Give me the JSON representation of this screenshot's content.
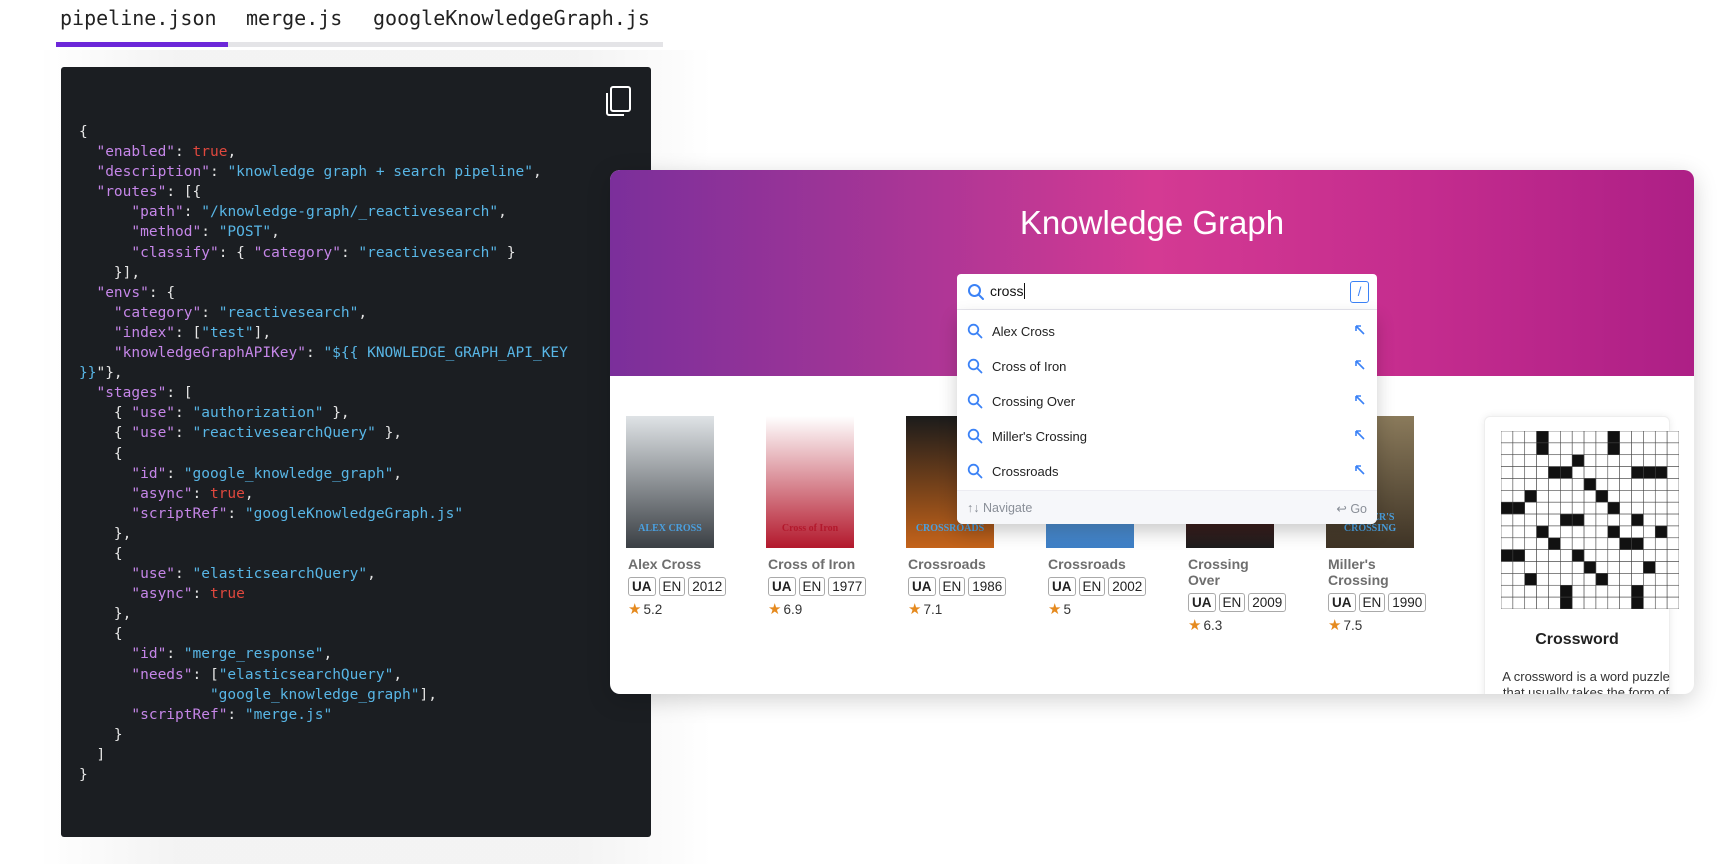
{
  "tabs": [
    {
      "label": "pipeline.json",
      "active": true
    },
    {
      "label": "merge.js",
      "active": false
    },
    {
      "label": "googleKnowledgeGraph.js",
      "active": false
    }
  ],
  "accent_color": "#6d28d9",
  "code_panel": {
    "copy_icon": "copy-icon",
    "lines": [
      [
        [
          "p",
          "{"
        ]
      ],
      [
        [
          "p",
          "  "
        ],
        [
          "k",
          "\"enabled\""
        ],
        [
          "p",
          ": "
        ],
        [
          "b",
          "true"
        ],
        [
          "p",
          ","
        ]
      ],
      [
        [
          "p",
          "  "
        ],
        [
          "k",
          "\"description\""
        ],
        [
          "p",
          ": "
        ],
        [
          "s",
          "\"knowledge graph + search pipeline\""
        ],
        [
          "p",
          ","
        ]
      ],
      [
        [
          "p",
          "  "
        ],
        [
          "k",
          "\"routes\""
        ],
        [
          "p",
          ": [{"
        ]
      ],
      [
        [
          "p",
          "      "
        ],
        [
          "k",
          "\"path\""
        ],
        [
          "p",
          ": "
        ],
        [
          "s",
          "\"/knowledge-graph/_reactivesearch\""
        ],
        [
          "p",
          ","
        ]
      ],
      [
        [
          "p",
          "      "
        ],
        [
          "k",
          "\"method\""
        ],
        [
          "p",
          ": "
        ],
        [
          "s",
          "\"POST\""
        ],
        [
          "p",
          ","
        ]
      ],
      [
        [
          "p",
          "      "
        ],
        [
          "k",
          "\"classify\""
        ],
        [
          "p",
          ": { "
        ],
        [
          "k",
          "\"category\""
        ],
        [
          "p",
          ": "
        ],
        [
          "s",
          "\"reactivesearch\""
        ],
        [
          "p",
          " }"
        ]
      ],
      [
        [
          "p",
          "    }],"
        ]
      ],
      [
        [
          "p",
          "  "
        ],
        [
          "k",
          "\"envs\""
        ],
        [
          "p",
          ": {"
        ]
      ],
      [
        [
          "p",
          "    "
        ],
        [
          "k",
          "\"category\""
        ],
        [
          "p",
          ": "
        ],
        [
          "s",
          "\"reactivesearch\""
        ],
        [
          "p",
          ","
        ]
      ],
      [
        [
          "p",
          "    "
        ],
        [
          "k",
          "\"index\""
        ],
        [
          "p",
          ": ["
        ],
        [
          "s",
          "\"test\""
        ],
        [
          "p",
          "],"
        ]
      ],
      [
        [
          "p",
          "    "
        ],
        [
          "k",
          "\"knowledgeGraphAPIKey\""
        ],
        [
          "p",
          ": "
        ],
        [
          "s",
          "\"${{ KNOWLEDGE_GRAPH_API_KEY"
        ]
      ],
      [
        [
          "s",
          "}}"
        ],
        [
          "p",
          "\"},"
        ]
      ],
      [
        [
          "p",
          "  "
        ],
        [
          "k",
          "\"stages\""
        ],
        [
          "p",
          ": ["
        ]
      ],
      [
        [
          "p",
          "    { "
        ],
        [
          "k",
          "\"use\""
        ],
        [
          "p",
          ": "
        ],
        [
          "s",
          "\"authorization\""
        ],
        [
          "p",
          " },"
        ]
      ],
      [
        [
          "p",
          "    { "
        ],
        [
          "k",
          "\"use\""
        ],
        [
          "p",
          ": "
        ],
        [
          "s",
          "\"reactivesearchQuery\""
        ],
        [
          "p",
          " },"
        ]
      ],
      [
        [
          "p",
          "    {"
        ]
      ],
      [
        [
          "p",
          "      "
        ],
        [
          "k",
          "\"id\""
        ],
        [
          "p",
          ": "
        ],
        [
          "s",
          "\"google_knowledge_graph\""
        ],
        [
          "p",
          ","
        ]
      ],
      [
        [
          "p",
          "      "
        ],
        [
          "k",
          "\"async\""
        ],
        [
          "p",
          ": "
        ],
        [
          "b",
          "true"
        ],
        [
          "p",
          ","
        ]
      ],
      [
        [
          "p",
          "      "
        ],
        [
          "k",
          "\"scriptRef\""
        ],
        [
          "p",
          ": "
        ],
        [
          "s",
          "\"googleKnowledgeGraph.js\""
        ]
      ],
      [
        [
          "p",
          "    },"
        ]
      ],
      [
        [
          "p",
          "    {"
        ]
      ],
      [
        [
          "p",
          "      "
        ],
        [
          "k",
          "\"use\""
        ],
        [
          "p",
          ": "
        ],
        [
          "s",
          "\"elasticsearchQuery\""
        ],
        [
          "p",
          ","
        ]
      ],
      [
        [
          "p",
          "      "
        ],
        [
          "k",
          "\"async\""
        ],
        [
          "p",
          ": "
        ],
        [
          "b",
          "true"
        ]
      ],
      [
        [
          "p",
          "    },"
        ]
      ],
      [
        [
          "p",
          "    {"
        ]
      ],
      [
        [
          "p",
          "      "
        ],
        [
          "k",
          "\"id\""
        ],
        [
          "p",
          ": "
        ],
        [
          "s",
          "\"merge_response\""
        ],
        [
          "p",
          ","
        ]
      ],
      [
        [
          "p",
          "      "
        ],
        [
          "k",
          "\"needs\""
        ],
        [
          "p",
          ": ["
        ],
        [
          "s",
          "\"elasticsearchQuery\""
        ],
        [
          "p",
          ","
        ]
      ],
      [
        [
          "p",
          "               "
        ],
        [
          "s",
          "\"google_knowledge_graph\""
        ],
        [
          "p",
          "],"
        ]
      ],
      [
        [
          "p",
          "      "
        ],
        [
          "k",
          "\"scriptRef\""
        ],
        [
          "p",
          ": "
        ],
        [
          "s",
          "\"merge.js\""
        ]
      ],
      [
        [
          "p",
          "    }"
        ]
      ],
      [
        [
          "p",
          "  ]"
        ]
      ],
      [
        [
          "p",
          "}"
        ]
      ]
    ]
  },
  "demo": {
    "title": "Knowledge Graph",
    "gradient": [
      "#7b2f9b",
      "#d43a93",
      "#ad1f86"
    ],
    "search": {
      "value": "cross",
      "shortcut": "/"
    },
    "suggestions": [
      "Alex Cross",
      "Cross of Iron",
      "Crossing Over",
      "Miller's Crossing",
      "Crossroads"
    ],
    "footer": {
      "navigate": "↑↓ Navigate",
      "go": "↩ Go"
    },
    "movies": [
      {
        "title": "Alex Cross",
        "lang": [
          "UA",
          "EN"
        ],
        "year": "2012",
        "rating": "5.2",
        "poster_text": "ALEX CROSS",
        "poster_colors": [
          "#dfe3e6",
          "#3a3f44"
        ]
      },
      {
        "title": "Cross of Iron",
        "lang": [
          "UA",
          "EN"
        ],
        "year": "1977",
        "rating": "6.9",
        "poster_text": "Cross of Iron",
        "poster_colors": [
          "#ffffff",
          "#b3182c"
        ]
      },
      {
        "title": "Crossroads",
        "lang": [
          "UA",
          "EN"
        ],
        "year": "1986",
        "rating": "7.1",
        "poster_text": "CROSSROADS",
        "poster_colors": [
          "#1b1b1b",
          "#c4631a"
        ]
      },
      {
        "title": "Crossroads",
        "lang": [
          "UA",
          "EN"
        ],
        "year": "2002",
        "rating": "5",
        "poster_text": "",
        "poster_colors": [
          "#8fc6f0",
          "#3d7fc6"
        ]
      },
      {
        "title": "Crossing Over",
        "lang": [
          "UA",
          "EN"
        ],
        "year": "2009",
        "rating": "6.3",
        "poster_text": "",
        "poster_colors": [
          "#c7221f",
          "#1d1d1d"
        ]
      },
      {
        "title": "Miller's Crossing",
        "lang": [
          "UA",
          "EN"
        ],
        "year": "1990",
        "rating": "7.5",
        "poster_text": "MILLER'S CROSSING",
        "poster_colors": [
          "#8a7a5b",
          "#3e3325"
        ]
      }
    ],
    "knowledge_card": {
      "title": "Crossword",
      "description": "A crossword is a word puzzle that usually takes the form of"
    }
  }
}
